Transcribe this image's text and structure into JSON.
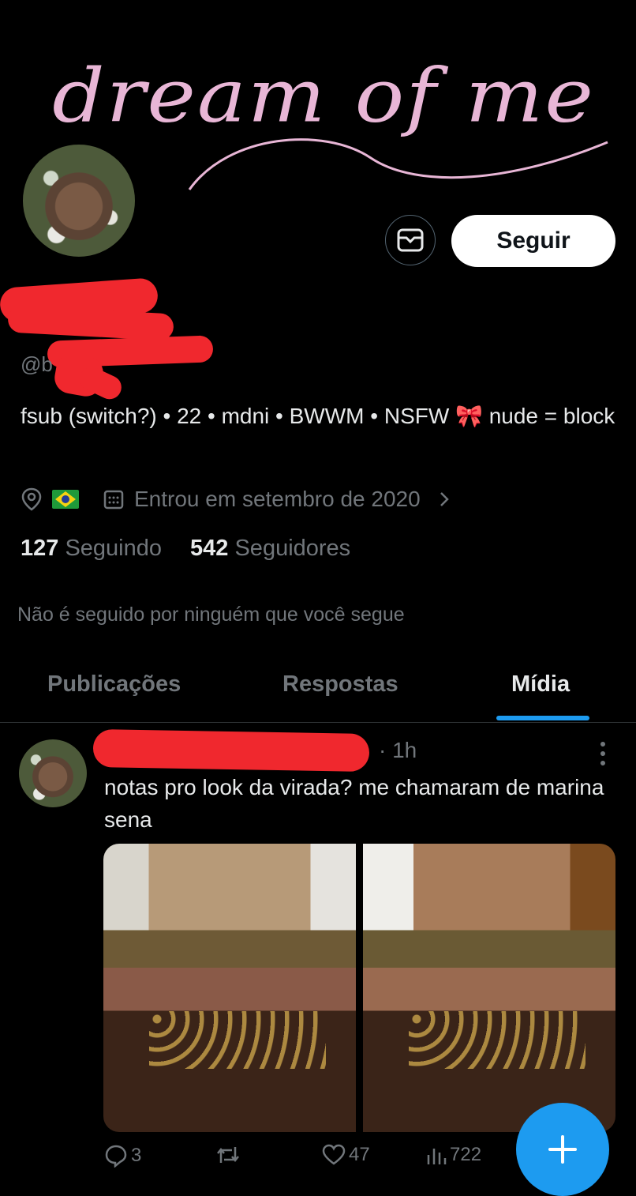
{
  "banner": {
    "title": "dream of me"
  },
  "profile": {
    "handle_prefix": "@b",
    "bio": "fsub (switch?) • 22 • mdni • BWWM • NSFW 🎀 nude = block",
    "location_flag": "🇧🇷",
    "joined": "Entrou em setembro de 2020",
    "following_count": "127",
    "following_label": "Seguindo",
    "followers_count": "542",
    "followers_label": "Seguidores",
    "not_followed_note": "Não é seguido por ninguém que você segue"
  },
  "buttons": {
    "follow_label": "Seguir"
  },
  "tabs": [
    {
      "label": "Publicações",
      "active": false
    },
    {
      "label": "Respostas",
      "active": false
    },
    {
      "label": "Mídia",
      "active": true
    }
  ],
  "post": {
    "time": "· 1h",
    "text": "notas pro look da virada? me chamaram de marina sena",
    "replies": "3",
    "reposts": "",
    "likes": "47",
    "views": "722"
  },
  "colors": {
    "accent": "#1d9bf0",
    "redaction": "#f0282e",
    "banner_text": "#e8b6d6"
  },
  "icons": [
    "mail-icon",
    "location-icon",
    "calendar-icon",
    "chevron-right-icon",
    "more-vertical-icon",
    "reply-icon",
    "repost-icon",
    "like-icon",
    "views-icon",
    "plus-icon"
  ]
}
